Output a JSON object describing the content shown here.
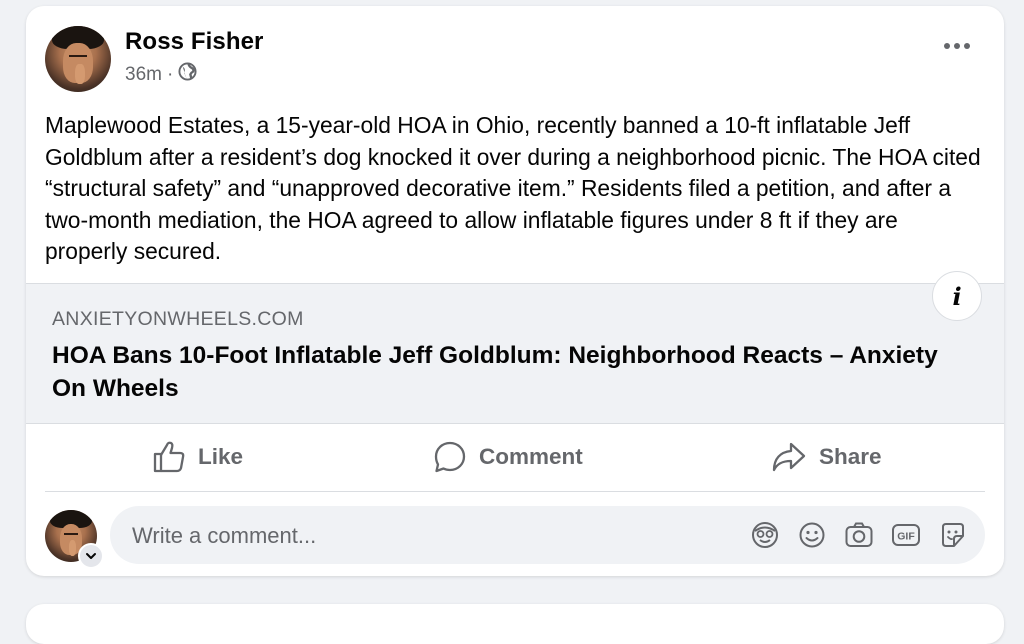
{
  "post": {
    "author": "Ross Fisher",
    "time": "36m",
    "separator": "·",
    "privacy_icon": "globe-icon",
    "text": "Maplewood Estates, a 15-year-old HOA in Ohio, recently banned a 10-ft inflatable Jeff Goldblum after a resident’s dog knocked it over during a neighborhood picnic. The HOA cited “structural safety” and “unapproved decorative item.” Residents filed a petition, and after a two-month mediation, the HOA agreed to allow inflatable figures under 8 ft if they are properly secured."
  },
  "link": {
    "domain": "ANXIETYONWHEELS.COM",
    "title": "HOA Bans 10-Foot Inflatable Jeff Goldblum: Neighborhood Reacts – Anxiety On Wheels",
    "info_glyph": "i"
  },
  "actions": {
    "like": "Like",
    "comment": "Comment",
    "share": "Share"
  },
  "comment_box": {
    "placeholder": "Write a comment..."
  },
  "colors": {
    "background": "#f0f2f5",
    "card": "#ffffff",
    "secondary_text": "#65676b",
    "primary_text": "#050505"
  }
}
